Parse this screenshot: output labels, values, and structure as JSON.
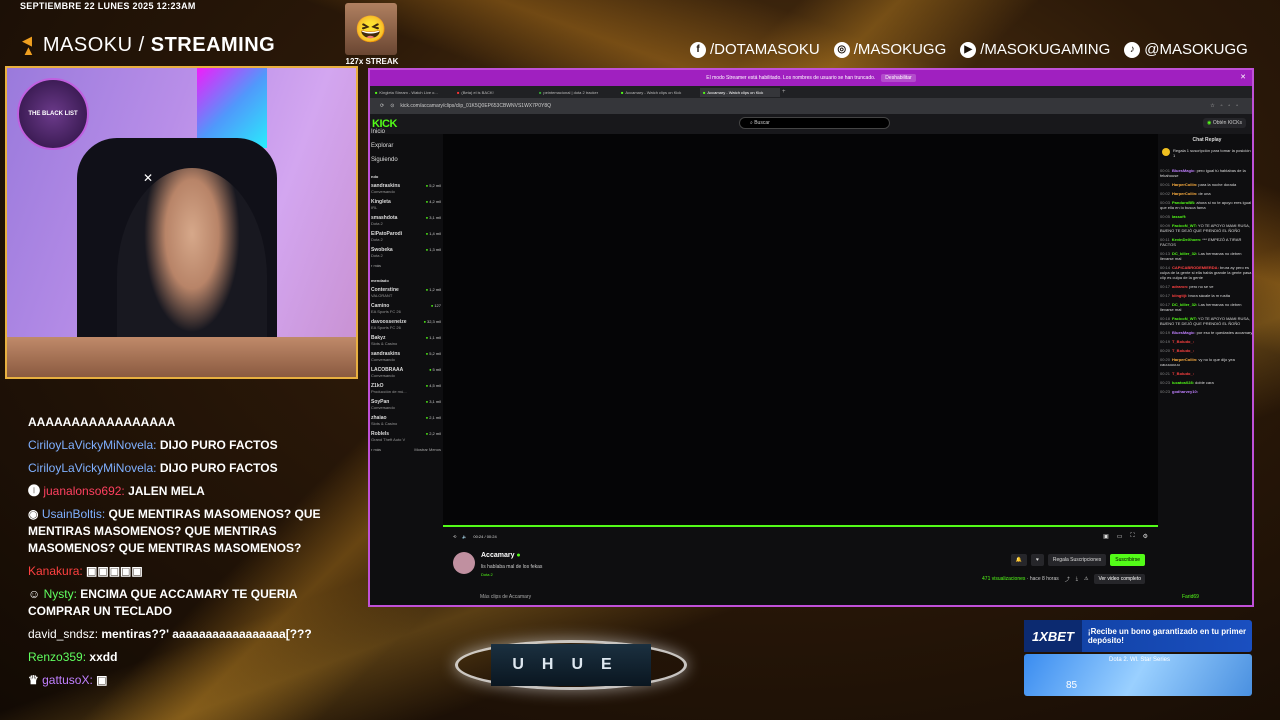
{
  "header": {
    "datetime": "SEPTIEMBRE 22 LUNES 2025 12:23AM",
    "brand_light": "MASOKU /",
    "brand_bold": "STREAMING",
    "streak_label": "127x STREAK"
  },
  "socials": [
    {
      "icon": "facebook-icon",
      "glyph": "f",
      "label": "/DOTAMASOKU"
    },
    {
      "icon": "instagram-icon",
      "glyph": "◎",
      "label": "/MASOKUGG"
    },
    {
      "icon": "youtube-icon",
      "glyph": "▶",
      "label": "/MASOKUGAMING"
    },
    {
      "icon": "tiktok-icon",
      "glyph": "♪",
      "label": "@MASOKUGG"
    }
  ],
  "cam": {
    "logo_text": "THE BLACK LIST"
  },
  "chat": [
    {
      "user": "",
      "user_color": "#ffffff",
      "text": "AAAAAAAAAAAAAAAAA"
    },
    {
      "user": "CiriloyLaVickyMiNovela:",
      "user_color": "#7fb0ff",
      "text": "DIJO PURO FACTOS"
    },
    {
      "user": "CiriloyLaVickyMiNovela:",
      "user_color": "#7fb0ff",
      "text": "DIJO PURO FACTOS"
    },
    {
      "user": "juanalonso692:",
      "user_color": "#ff4060",
      "text": "JALEN MELA"
    },
    {
      "user": "UsainBoltis:",
      "user_color": "#7fb0ff",
      "text": "QUE MENTIRAS MASOMENOS? QUE MENTIRAS MASOMENOS? QUE MENTIRAS MASOMENOS? QUE MENTIRAS MASOMENOS?"
    },
    {
      "user": "Kanakura:",
      "user_color": "#ff4040",
      "text": ""
    },
    {
      "user": "Nysty:",
      "user_color": "#60ff60",
      "text": "ENCIMA QUE ACCAMARY TE QUERIA COMPRAR UN TECLADO"
    },
    {
      "user": "david_sndsz:",
      "user_color": "#ffffff",
      "text": "mentiras??' aaaaaaaaaaaaaaaaa[???"
    },
    {
      "user": "Renzo359:",
      "user_color": "#60ff60",
      "text": "xxdd"
    },
    {
      "user": "gattusoX:",
      "user_color": "#c080ff",
      "text": ""
    }
  ],
  "browser": {
    "banner_text": "El modo Streamer está habilitado. Los nombres de usuario se han truncado.",
    "banner_button": "Deshabilitar",
    "tabs": [
      "Kingleta Stream - Watch Live o...",
      "(Beta) el is BACK!",
      "peintemacional | dota 2 tracker",
      "Accamary - Watch clips on Kick",
      "Accamary - Watch clips on Kick"
    ],
    "url": "kick.com/accamary/clips/clip_01K5Q0EP653CBWNVS1WX7P0Y8Q",
    "logo": "KICK",
    "search_placeholder": "Buscar",
    "get_kicks": "Obtén KICKs",
    "nav": [
      "Inicio",
      "Explorar",
      "Siguiendo"
    ],
    "sec_following": "ndo",
    "following": [
      {
        "name": "sandraskins",
        "cat": "Conversando",
        "views": "5,2 mil"
      },
      {
        "name": "Kingleta",
        "cat": "IRL",
        "views": "4,2 mil"
      },
      {
        "name": "smashdota",
        "cat": "Dota 2",
        "views": "3,1 mil"
      },
      {
        "name": "ElPatoParodi",
        "cat": "Dota 2",
        "views": "1,4 mil"
      },
      {
        "name": "Swobeka",
        "cat": "Dota 2",
        "views": "1,3 mil"
      }
    ],
    "more_label": "r más",
    "sec_recommended": "mendado",
    "recommended": [
      {
        "name": "Conterstine",
        "cat": "VALORANT",
        "views": "1,2 mil"
      },
      {
        "name": "Camino",
        "cat": "EA Sports FC 26",
        "views": "127"
      },
      {
        "name": "davoosseneize",
        "cat": "EA Sports FC 26",
        "views": "32,3 mil"
      },
      {
        "name": "Bakyz",
        "cat": "Slots & Casino",
        "views": "1,1 mil"
      },
      {
        "name": "sandraskins",
        "cat": "Conversando",
        "views": "5,2 mil"
      },
      {
        "name": "LACOBRAAA",
        "cat": "Conversando",
        "views": "5 mil"
      },
      {
        "name": "Z1kO",
        "cat": "Producción de mú...",
        "views": "4,5 mil"
      },
      {
        "name": "SoyPan",
        "cat": "Conversando",
        "views": "3,1 mil"
      },
      {
        "name": "zhaiao",
        "cat": "Slots & Casino",
        "views": "2,1 mil"
      },
      {
        "name": "Roblels",
        "cat": "Grand Theft Auto V",
        "views": "2,2 mil"
      }
    ],
    "show_more": "Mostrar Menos",
    "time": "00:24 / 00:24",
    "channel": "Accamary",
    "clip_title": "lis hablaba mal de los fekas",
    "clip_category": "Dota 2",
    "gift_button": "Regala Suscripciones",
    "subscribe_button": "Suscribirse",
    "views": "471 visualizaciones",
    "time_ago": "hace 8 horas",
    "full_video": "Ver video completo",
    "more_clips": "Más clips de Accamary",
    "chat_title": "Chat Replay",
    "pinned": "Regala 1 suscripción para tomar la posición 1",
    "chat_lines": [
      {
        "t": "00:01",
        "u": "BluesMagic:",
        "c": "p",
        "m": "pero igual tú hablabas de la fekahouse"
      },
      {
        "t": "00:01",
        "u": "HarperCollin:",
        "c": "o",
        "m": "para la noche dorada"
      },
      {
        "t": "00:02",
        "u": "HarperCollin:",
        "c": "o",
        "m": "de una"
      },
      {
        "t": "00:03",
        "u": "PanduroBB:",
        "c": "g",
        "m": "ahora si no te apoyo eres igual que ella en lo busca fama"
      },
      {
        "t": "00:05",
        "u": "lassoff:",
        "c": "g",
        "m": ""
      },
      {
        "t": "00:09",
        "u": "FacicoN_WT:",
        "c": "g",
        "m": "YO TE APOYO MAMI RUSA, BUENO TE DEJÓ QUE PRENDIÓ EL ÑOÑO"
      },
      {
        "t": "00:11",
        "u": "KevinDeXhoen:",
        "c": "g",
        "m": "*** EMPEZÓ A TIRAR FACTOS"
      },
      {
        "t": "00:13",
        "u": "DC_killer_32:",
        "c": "g",
        "m": "Las hermanas no deben llevarse mal"
      },
      {
        "t": "00:14",
        "u": "CAPICABRODEMIERDA:",
        "c": "r",
        "m": "brura ay pero es culpa de la gente si ella habla grande la gente pasa clip es culpa de la gente"
      },
      {
        "t": "00:17",
        "u": "adraron:",
        "c": "r",
        "m": "pero no se ve"
      },
      {
        "t": "00:17",
        "u": "kiingtiji:",
        "c": "r",
        "m": "brura sácale la m rusita"
      },
      {
        "t": "00:17",
        "u": "DC_killer_32:",
        "c": "g",
        "m": "Las hermanas no deben llevarse mal"
      },
      {
        "t": "00:18",
        "u": "FacicoN_WT:",
        "c": "g",
        "m": "YO TE APOYO MAMI RUSA, BUENO TE DEJÓ QUE PRENDIÓ EL ÑOÑO"
      },
      {
        "t": "00:19",
        "u": "BluesMagic:",
        "c": "p",
        "m": "por eso te quedastes accamary"
      },
      {
        "t": "00:19",
        "u": "T_Boludo_:",
        "c": "r",
        "m": ""
      },
      {
        "t": "00:20",
        "u": "T_Boludo_:",
        "c": "r",
        "m": ""
      },
      {
        "t": "00:20",
        "u": "HarperCollin:",
        "c": "o",
        "m": "vy no lo que dijo yea cauuuuuuu"
      },
      {
        "t": "00:21",
        "u": "T_Boludo_:",
        "c": "r",
        "m": ""
      },
      {
        "t": "00:23",
        "u": "lucatos028:",
        "c": "g",
        "m": "doble cara"
      },
      {
        "t": "00:23",
        "u": "godharvey10:",
        "c": "p",
        "m": ""
      }
    ],
    "bottom_user": "Farid69"
  },
  "bet": {
    "logo": "1XBET",
    "text": "¡Recibe un bono garantizado en tu primer depósito!",
    "banner_caption": "Dota 2. Wl. Star Series",
    "banner_number": "85"
  },
  "center_logo": "UHUE"
}
